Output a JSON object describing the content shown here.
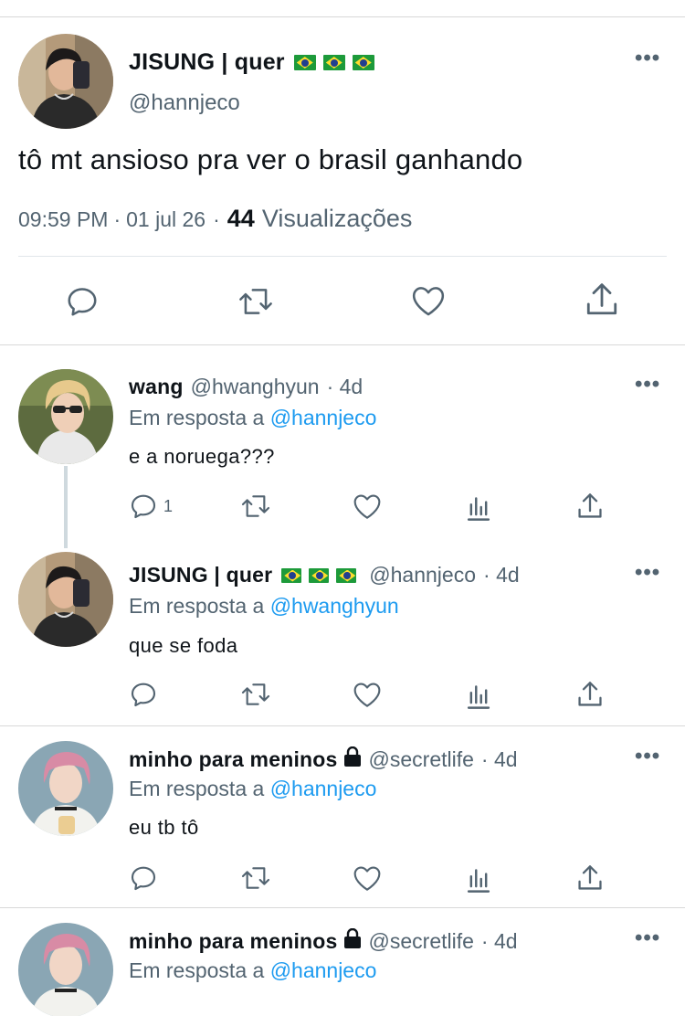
{
  "main_tweet": {
    "name": "JISUNG | quer",
    "flags": [
      "brazil-flag",
      "brazil-flag",
      "brazil-flag"
    ],
    "handle": "@hannjeco",
    "text": "tô mt ansioso pra ver o brasil ganhando",
    "time": "09:59 PM",
    "date": "01 jul 26",
    "dot": "·",
    "views_count": "44",
    "views_label": "Visualizações",
    "actions": [
      "reply-icon",
      "retweet-icon",
      "like-icon",
      "share-icon"
    ]
  },
  "replies": [
    {
      "name": "wang",
      "handle": "@hwanghyun",
      "time": "· 4d",
      "reply_prefix": "Em resposta a",
      "reply_to": "@hannjeco",
      "text": "e a noruega???",
      "reply_count": "1"
    },
    {
      "name": "JISUNG | quer",
      "handle": "@hannjeco",
      "time": "· 4d",
      "reply_prefix": "Em resposta a",
      "reply_to": "@hwanghyun",
      "text": "que se foda"
    },
    {
      "name": "minho para meninos",
      "handle": "@secretlife",
      "time": "· 4d",
      "reply_prefix": "Em resposta a",
      "reply_to": "@hannjeco",
      "text": "eu tb tô"
    },
    {
      "name": "minho para meninos",
      "handle": "@secretlife",
      "time": "· 4d",
      "reply_prefix": "Em resposta a",
      "reply_to": "@hannjeco",
      "text": ""
    }
  ],
  "colors": {
    "link": "#1d9bf0",
    "muted": "#536471",
    "text": "#0f1419",
    "flag_green": "#1d9a3a",
    "flag_yellow": "#fedd2d",
    "flag_blue": "#213f8f"
  }
}
